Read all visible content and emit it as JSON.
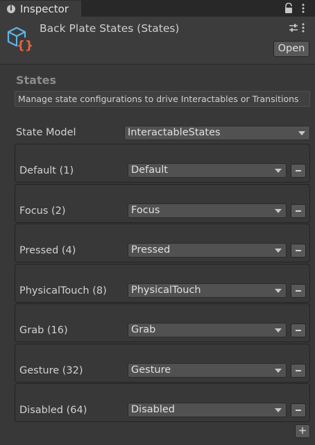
{
  "tab": {
    "label": "Inspector"
  },
  "header": {
    "title": "Back Plate States (States)",
    "open_label": "Open"
  },
  "section": {
    "title": "States",
    "help": "Manage state configurations to drive Interactables or Transitions"
  },
  "state_model": {
    "label": "State Model",
    "value": "InteractableStates"
  },
  "states": [
    {
      "label": "Default (1)",
      "value": "Default"
    },
    {
      "label": "Focus (2)",
      "value": "Focus"
    },
    {
      "label": "Pressed (4)",
      "value": "Pressed"
    },
    {
      "label": "PhysicalTouch (8)",
      "value": "PhysicalTouch"
    },
    {
      "label": "Grab (16)",
      "value": "Grab"
    },
    {
      "label": "Gesture (32)",
      "value": "Gesture"
    },
    {
      "label": "Disabled (64)",
      "value": "Disabled"
    }
  ],
  "add_label": "+",
  "colors": {
    "background": "#383838",
    "tabbar": "#282828",
    "asset_icon_blue": "#5fb5e8",
    "asset_icon_orange": "#e8643c"
  }
}
